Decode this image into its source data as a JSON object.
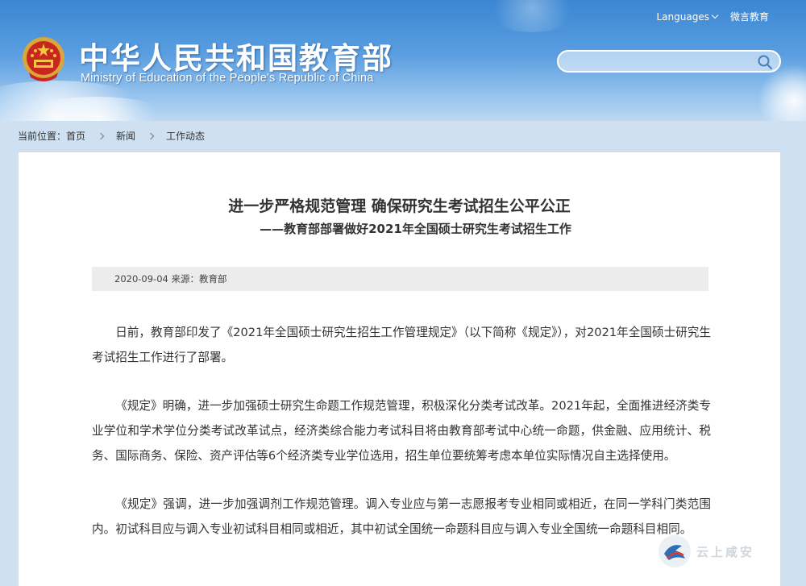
{
  "header": {
    "site_title": "中华人民共和国教育部",
    "site_subtitle": "Ministry of Education of the People's Republic of China",
    "top_links": {
      "languages": "Languages",
      "weibo": "微言教育"
    },
    "search": {
      "placeholder": ""
    }
  },
  "breadcrumb": {
    "prefix": "当前位置：",
    "items": [
      "首页",
      "新闻",
      "工作动态"
    ]
  },
  "article": {
    "title": "进一步严格规范管理 确保研究生考试招生公平公正",
    "subtitle": "——教育部部署做好2021年全国硕士研究生考试招生工作",
    "meta": "2020-09-04 来源：教育部",
    "paragraphs": [
      "日前，教育部印发了《2021年全国硕士研究生招生工作管理规定》（以下简称《规定》），对2021年全国硕士研究生考试招生工作进行了部署。",
      "《规定》明确，进一步加强硕士研究生命题工作规范管理，积极深化分类考试改革。2021年起，全面推进经济类专业学位和学术学位分类考试改革试点，经济类综合能力考试科目将由教育部考试中心统一命题，供金融、应用统计、税务、国际商务、保险、资产评估等6个经济类专业学位选用，招生单位要统筹考虑本单位实际情况自主选择使用。",
      "《规定》强调，进一步加强调剂工作规范管理。调入专业应与第一志愿报考专业相同或相近，在同一学科门类范围内。初试科目应与调入专业初试科目相同或相近，其中初试全国统一命题科目应与调入专业全国统一命题科目相同。"
    ]
  },
  "watermark": {
    "text": "云上咸安"
  },
  "colors": {
    "header_top": "#3a86d2",
    "header_bottom": "#bcd8f2",
    "page_bg": "#cfe0f1",
    "meta_bg": "#ececec",
    "text": "#333333"
  },
  "icons": {
    "emblem": "national-emblem-icon",
    "search": "search-icon",
    "chevron": "chevron-down-icon",
    "separator": "chevron-right-icon"
  }
}
